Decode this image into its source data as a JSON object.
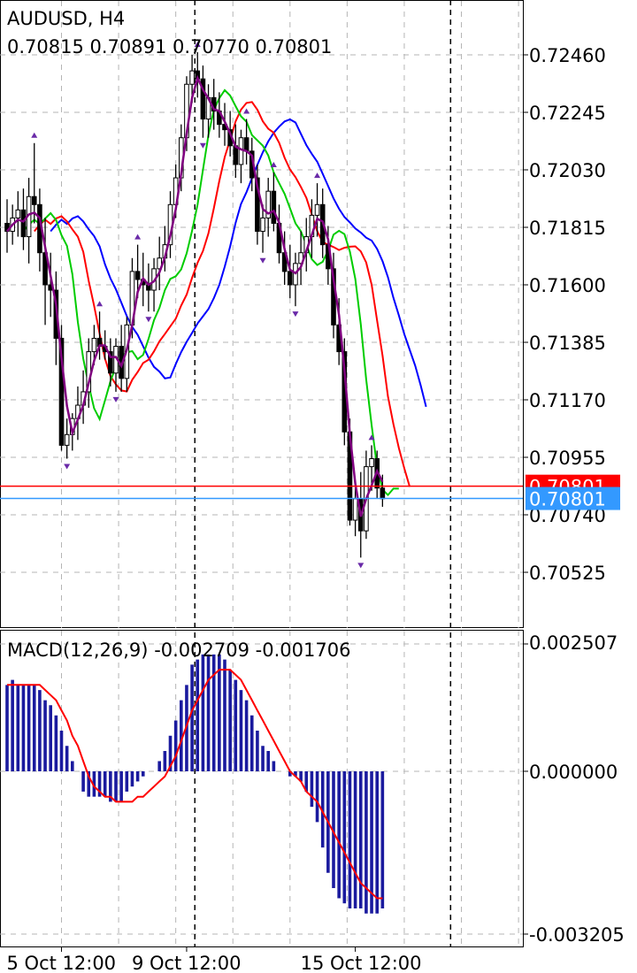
{
  "header": {
    "symbol_timeframe": "AUDUSD, H4",
    "ohlc": "0.70815 0.70891 0.70770 0.70801"
  },
  "colors": {
    "candle": "#000000",
    "ma_fast": "#00cc00",
    "ma_mid": "#ff0000",
    "ma_slow": "#0000ff",
    "ma_signal": "#800080",
    "macd_hist": "#1a1a9e",
    "macd_signal": "#ff0000",
    "bid_line": "#ff0000",
    "ask_line": "#3399ff",
    "fractal": "#6a2aa8"
  },
  "chart_data": [
    {
      "type": "candlestick",
      "title": "AUDUSD, H4",
      "ylim": [
        0.7041,
        0.7262
      ],
      "y_ticks": [
        "0.72460",
        "0.72245",
        "0.72030",
        "0.71815",
        "0.71600",
        "0.71385",
        "0.71170",
        "0.70955",
        "0.70740",
        "0.70525"
      ],
      "y_tick_values": [
        0.7246,
        0.72245,
        0.7203,
        0.71815,
        0.716,
        0.71385,
        0.7117,
        0.70955,
        0.7074,
        0.70525
      ],
      "x_tick_labels": [
        "5 Oct 12:00",
        "9 Oct 12:00",
        "15 Oct 12:00"
      ],
      "x_tick_bar_index": [
        10,
        33,
        64
      ],
      "period_separators_bar_index": [
        35,
        82
      ],
      "bid_price_label": "0.70801",
      "bid_price": 0.70847,
      "ask_price_label": "0.70801",
      "ask_price": 0.70801,
      "candles": [
        [
          0.7183,
          0.7192,
          0.7172,
          0.718
        ],
        [
          0.718,
          0.719,
          0.7175,
          0.7185
        ],
        [
          0.7185,
          0.7195,
          0.7178,
          0.7188
        ],
        [
          0.7188,
          0.7196,
          0.7173,
          0.7178
        ],
        [
          0.7178,
          0.72,
          0.7168,
          0.7193
        ],
        [
          0.7193,
          0.7213,
          0.7183,
          0.719
        ],
        [
          0.719,
          0.7196,
          0.7165,
          0.7172
        ],
        [
          0.7172,
          0.7185,
          0.7145,
          0.716
        ],
        [
          0.716,
          0.7172,
          0.7148,
          0.7158
        ],
        [
          0.7158,
          0.7165,
          0.713,
          0.714
        ],
        [
          0.714,
          0.7145,
          0.7098,
          0.71
        ],
        [
          0.71,
          0.711,
          0.7095,
          0.7104
        ],
        [
          0.7104,
          0.7112,
          0.7098,
          0.711
        ],
        [
          0.711,
          0.7122,
          0.7102,
          0.7115
        ],
        [
          0.7115,
          0.7128,
          0.7108,
          0.712
        ],
        [
          0.712,
          0.714,
          0.7114,
          0.7135
        ],
        [
          0.7135,
          0.7145,
          0.713,
          0.714
        ],
        [
          0.714,
          0.715,
          0.7132,
          0.7137
        ],
        [
          0.7137,
          0.7143,
          0.7132,
          0.7135
        ],
        [
          0.7135,
          0.714,
          0.7122,
          0.7127
        ],
        [
          0.7127,
          0.714,
          0.712,
          0.7137
        ],
        [
          0.7137,
          0.7145,
          0.712,
          0.7125
        ],
        [
          0.7125,
          0.7148,
          0.712,
          0.7145
        ],
        [
          0.7145,
          0.717,
          0.714,
          0.7165
        ],
        [
          0.7165,
          0.7175,
          0.7155,
          0.7162
        ],
        [
          0.7162,
          0.7172,
          0.7152,
          0.716
        ],
        [
          0.716,
          0.7168,
          0.715,
          0.7158
        ],
        [
          0.7158,
          0.717,
          0.715,
          0.7166
        ],
        [
          0.7166,
          0.7178,
          0.7158,
          0.717
        ],
        [
          0.717,
          0.7182,
          0.7165,
          0.7175
        ],
        [
          0.7175,
          0.7195,
          0.717,
          0.719
        ],
        [
          0.719,
          0.7205,
          0.7185,
          0.72
        ],
        [
          0.72,
          0.722,
          0.7195,
          0.7215
        ],
        [
          0.7215,
          0.7238,
          0.721,
          0.7235
        ],
        [
          0.7235,
          0.7246,
          0.7228,
          0.724
        ],
        [
          0.724,
          0.7247,
          0.723,
          0.7237
        ],
        [
          0.7237,
          0.7242,
          0.7215,
          0.7222
        ],
        [
          0.7222,
          0.7235,
          0.7215,
          0.723
        ],
        [
          0.723,
          0.7237,
          0.7218,
          0.7225
        ],
        [
          0.7225,
          0.7232,
          0.7215,
          0.722
        ],
        [
          0.722,
          0.7228,
          0.7212,
          0.7218
        ],
        [
          0.7218,
          0.7225,
          0.7208,
          0.7212
        ],
        [
          0.7212,
          0.722,
          0.72,
          0.7205
        ],
        [
          0.7205,
          0.7218,
          0.7198,
          0.7215
        ],
        [
          0.7215,
          0.7222,
          0.7205,
          0.721
        ],
        [
          0.721,
          0.7215,
          0.7195,
          0.72
        ],
        [
          0.72,
          0.7205,
          0.7175,
          0.718
        ],
        [
          0.718,
          0.719,
          0.7172,
          0.7185
        ],
        [
          0.7185,
          0.72,
          0.7178,
          0.7195
        ],
        [
          0.7195,
          0.7202,
          0.718,
          0.7183
        ],
        [
          0.7183,
          0.719,
          0.7168,
          0.7172
        ],
        [
          0.7172,
          0.718,
          0.716,
          0.7165
        ],
        [
          0.7165,
          0.7175,
          0.7155,
          0.716
        ],
        [
          0.716,
          0.7172,
          0.7152,
          0.7168
        ],
        [
          0.7168,
          0.718,
          0.716,
          0.7172
        ],
        [
          0.7172,
          0.7185,
          0.7165,
          0.7178
        ],
        [
          0.7178,
          0.7192,
          0.717,
          0.7186
        ],
        [
          0.7186,
          0.7198,
          0.7178,
          0.719
        ],
        [
          0.719,
          0.7196,
          0.717,
          0.7175
        ],
        [
          0.7175,
          0.7182,
          0.716,
          0.7166
        ],
        [
          0.7166,
          0.7172,
          0.714,
          0.7145
        ],
        [
          0.7145,
          0.7155,
          0.713,
          0.7135
        ],
        [
          0.7135,
          0.714,
          0.71,
          0.7105
        ],
        [
          0.7105,
          0.711,
          0.707,
          0.7072
        ],
        [
          0.7072,
          0.7085,
          0.7066,
          0.708
        ],
        [
          0.708,
          0.709,
          0.7058,
          0.7068
        ],
        [
          0.7068,
          0.7098,
          0.7065,
          0.7092
        ],
        [
          0.7092,
          0.71,
          0.7083,
          0.7095
        ],
        [
          0.7095,
          0.7098,
          0.708,
          0.7084
        ],
        [
          0.7084,
          0.7089,
          0.7077,
          0.708
        ]
      ]
    },
    {
      "type": "bar",
      "title": "MACD(12,26,9)",
      "macd_value": "-0.002709",
      "signal_value": "-0.001706",
      "ylim": [
        -0.003205,
        0.002507
      ],
      "y_ticks": [
        "0.002507",
        "0.000000",
        "-0.003205"
      ],
      "y_tick_values": [
        0.002507,
        0.0,
        -0.003205
      ],
      "histogram": [
        0.0017,
        0.0018,
        0.0017,
        0.0017,
        0.0017,
        0.0017,
        0.0016,
        0.0014,
        0.0013,
        0.0011,
        0.0008,
        0.0005,
        0.0002,
        0.0,
        -0.0004,
        -0.0005,
        -0.0005,
        -0.0005,
        -0.0005,
        -0.0006,
        -0.0006,
        -0.0006,
        -0.0004,
        -0.0003,
        -0.0002,
        -0.0001,
        0.0,
        0.0,
        0.0002,
        0.0004,
        0.0007,
        0.001,
        0.0014,
        0.0017,
        0.0021,
        0.0022,
        0.0023,
        0.0023,
        0.0023,
        0.0023,
        0.0022,
        0.002,
        0.0018,
        0.0016,
        0.0014,
        0.0011,
        0.0008,
        0.0005,
        0.0004,
        0.0002,
        0.0,
        0.0,
        -0.0001,
        -0.0001,
        -0.0002,
        -0.0004,
        -0.0007,
        -0.001,
        -0.0015,
        -0.002,
        -0.0023,
        -0.0025,
        -0.0026,
        -0.0027,
        -0.0027,
        -0.0027,
        -0.0028,
        -0.0028,
        -0.0028,
        -0.0027
      ],
      "signal": [
        0.0017,
        0.0017,
        0.0017,
        0.0017,
        0.0017,
        0.0017,
        0.0017,
        0.0016,
        0.0015,
        0.0014,
        0.0012,
        0.001,
        0.0007,
        0.0005,
        0.0002,
        -0.0001,
        -0.0003,
        -0.0004,
        -0.0005,
        -0.0005,
        -0.0006,
        -0.0006,
        -0.0006,
        -0.0006,
        -0.0005,
        -0.0005,
        -0.0004,
        -0.0003,
        -0.0002,
        -0.0001,
        0.0001,
        0.0003,
        0.0006,
        0.0009,
        0.0012,
        0.0014,
        0.0016,
        0.0018,
        0.0019,
        0.002,
        0.002,
        0.002,
        0.0019,
        0.0018,
        0.0016,
        0.0014,
        0.0012,
        0.001,
        0.0008,
        0.0006,
        0.0004,
        0.0002,
        0.0,
        -0.0001,
        -0.0002,
        -0.0004,
        -0.0005,
        -0.0006,
        -0.0008,
        -0.001,
        -0.0012,
        -0.0014,
        -0.0016,
        -0.0018,
        -0.002,
        -0.0022,
        -0.0023,
        -0.0024,
        -0.0025,
        -0.0025
      ]
    }
  ]
}
